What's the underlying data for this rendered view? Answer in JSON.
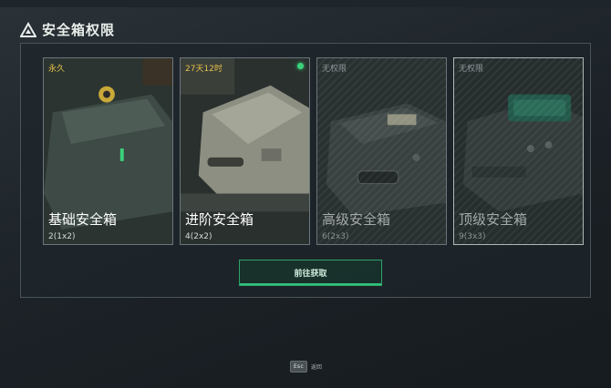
{
  "header": {
    "title": "安全箱权限",
    "icon": "warning-triangle-icon"
  },
  "cards": [
    {
      "tag": "永久",
      "name": "基础安全箱",
      "capacity": "2(1x2)",
      "state": "owned",
      "active_indicator": false
    },
    {
      "tag": "27天12时",
      "name": "进阶安全箱",
      "capacity": "4(2x2)",
      "state": "owned",
      "active_indicator": true
    },
    {
      "tag": "无权限",
      "name": "高级安全箱",
      "capacity": "6(2x3)",
      "state": "locked",
      "active_indicator": false
    },
    {
      "tag": "无权限",
      "name": "顶级安全箱",
      "capacity": "9(3x3)",
      "state": "locked",
      "active_indicator": false,
      "selected": true
    }
  ],
  "actions": {
    "get_label": "前往获取"
  },
  "footer": {
    "esc_key": "Esc",
    "back_label": "返回"
  },
  "colors": {
    "accent_green": "#2fc27c",
    "tag_gold": "#e6c24a",
    "status_dot": "#3bd17a"
  }
}
